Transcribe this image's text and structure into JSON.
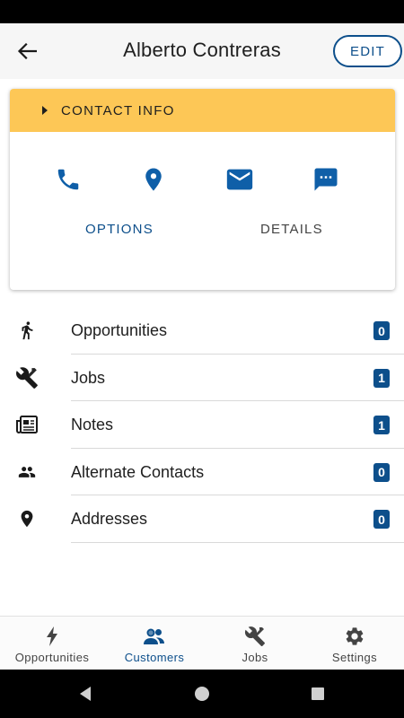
{
  "header": {
    "title": "Alberto Contreras",
    "edit_label": "EDIT"
  },
  "contact_card": {
    "header_label": "CONTACT INFO",
    "actions": [
      {
        "icon": "phone-icon"
      },
      {
        "icon": "location-pin-icon"
      },
      {
        "icon": "email-icon"
      },
      {
        "icon": "message-icon"
      }
    ],
    "tabs": [
      {
        "label": "OPTIONS",
        "active": true
      },
      {
        "label": "DETAILS",
        "active": false
      }
    ]
  },
  "rows": [
    {
      "label": "Opportunities",
      "count": "0",
      "icon": "walking-person-icon"
    },
    {
      "label": "Jobs",
      "count": "1",
      "icon": "tools-icon"
    },
    {
      "label": "Notes",
      "count": "1",
      "icon": "newspaper-icon"
    },
    {
      "label": "Alternate Contacts",
      "count": "0",
      "icon": "people-icon"
    },
    {
      "label": "Addresses",
      "count": "0",
      "icon": "location-pin-icon"
    }
  ],
  "bottom_nav": [
    {
      "label": "Opportunities",
      "icon": "lightning-icon",
      "active": false
    },
    {
      "label": "Customers",
      "icon": "customers-icon",
      "active": true
    },
    {
      "label": "Jobs",
      "icon": "tools-icon",
      "active": false
    },
    {
      "label": "Settings",
      "icon": "gear-icon",
      "active": false
    }
  ],
  "colors": {
    "accent": "#0d4f8b",
    "card_header": "#fdc756",
    "badge": "#0d4f8b",
    "action_icon": "#0f5fa8"
  }
}
